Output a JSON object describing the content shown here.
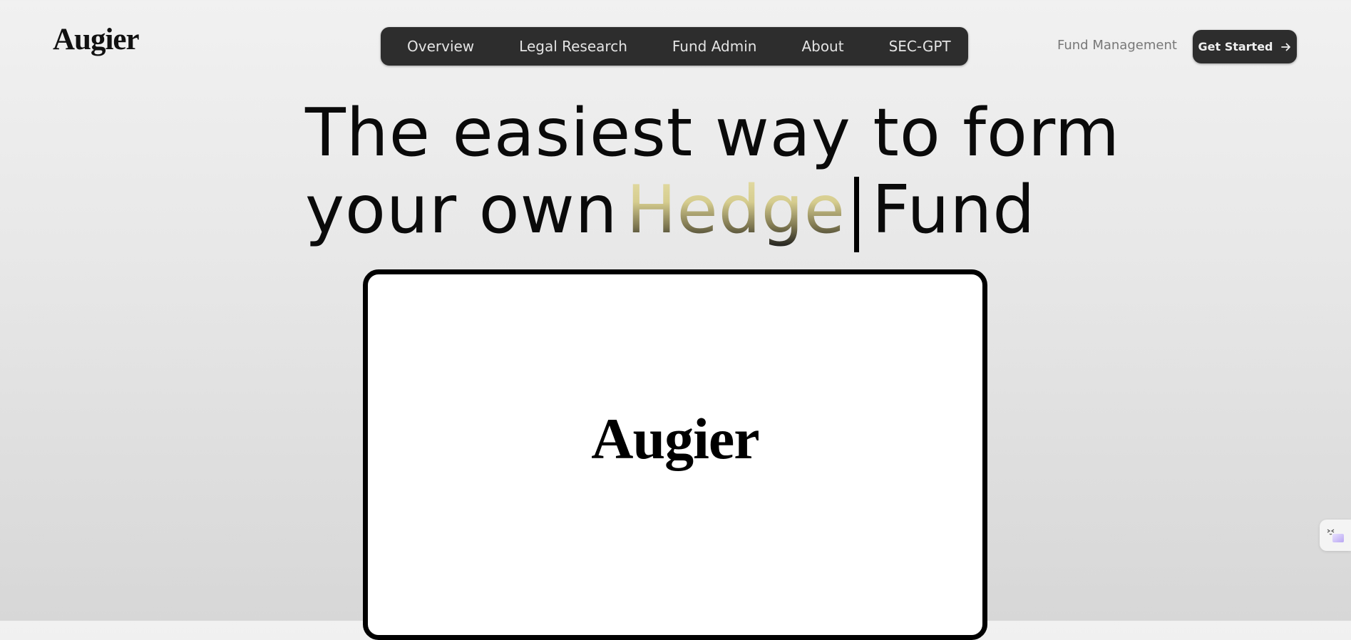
{
  "brand": {
    "name": "Augier"
  },
  "nav": {
    "items": [
      {
        "label": "Overview"
      },
      {
        "label": "Legal Research"
      },
      {
        "label": "Fund Admin"
      },
      {
        "label": "About"
      },
      {
        "label": "SEC-GPT"
      }
    ]
  },
  "header": {
    "secondary_link": "Fund Management",
    "cta_label": "Get Started",
    "cta_icon": "arrow-right-icon"
  },
  "hero": {
    "line1": "The easiest way to form",
    "line2_prefix": "your own",
    "line2_highlight": "Hedge",
    "line2_suffix": "Fund"
  },
  "preview_card": {
    "logo_text": "Augier"
  },
  "widget": {
    "icon": "chat-face-icon"
  },
  "colors": {
    "nav_bg": "#2d2d2d",
    "nav_text": "#e4e4e4",
    "highlight_top": "#e6dfa9",
    "highlight_bottom": "#1b1b1b",
    "link_gray": "#777777"
  }
}
